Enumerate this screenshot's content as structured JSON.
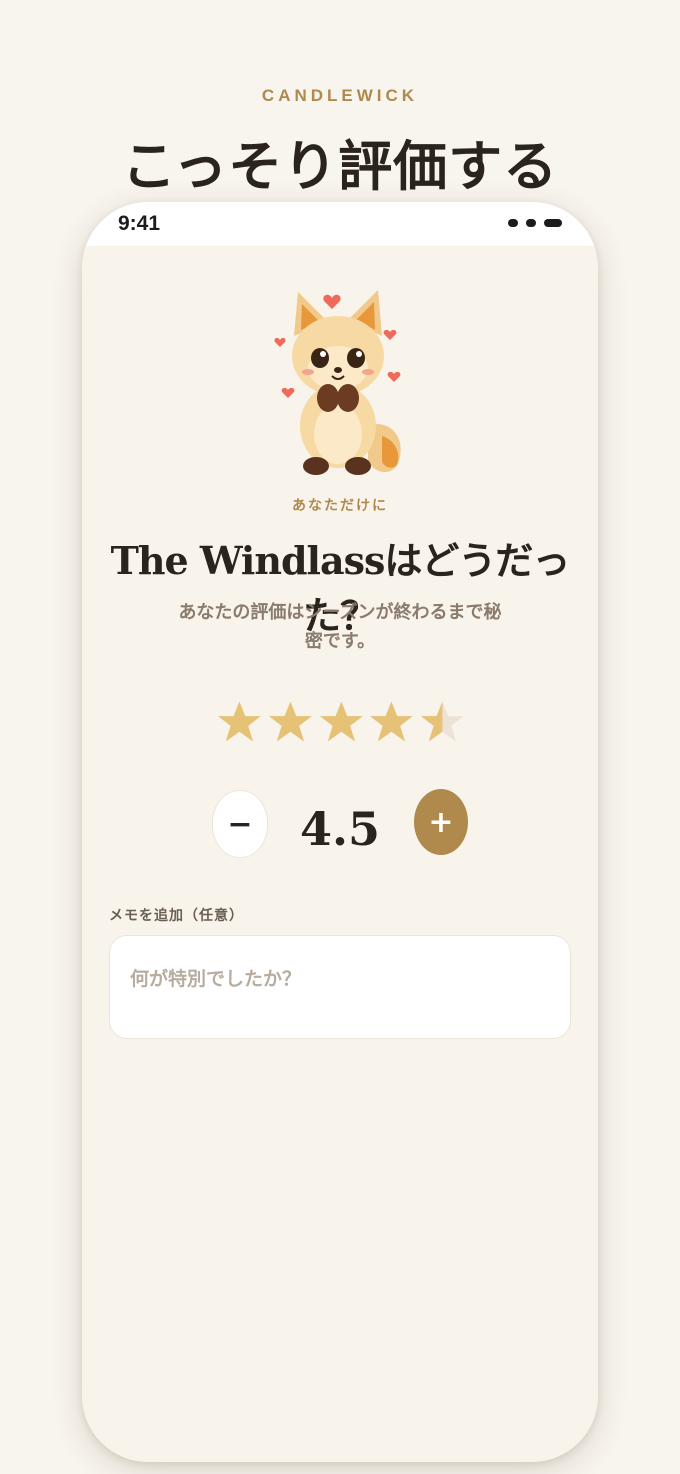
{
  "header": {
    "brand": "CANDLEWICK",
    "title": "こっそり評価する"
  },
  "status_bar": {
    "time": "9:41"
  },
  "content": {
    "eyebrow": "あなただけに",
    "question": "The Windlassはどうだった？",
    "subtitle": "あなたの評価はシーズンが終わるまで秘密です。",
    "rating": {
      "value": "4.5",
      "max_stars": 5,
      "filled_stars": 4.5,
      "minus_label": "−",
      "plus_label": "+"
    },
    "memo": {
      "label": "メモを追加（任意）",
      "placeholder": "何が特別でしたか？",
      "value": ""
    }
  },
  "icons": [
    "fox-mascot-icon",
    "star-icon",
    "minus-icon",
    "plus-icon"
  ],
  "colors": {
    "background": "#f8f4ee",
    "accent": "#b08a4c",
    "star_filled": "#e6c277",
    "star_empty": "#ebe3d6",
    "text_dark": "#2a241d",
    "text_muted": "#8a7b6c"
  }
}
